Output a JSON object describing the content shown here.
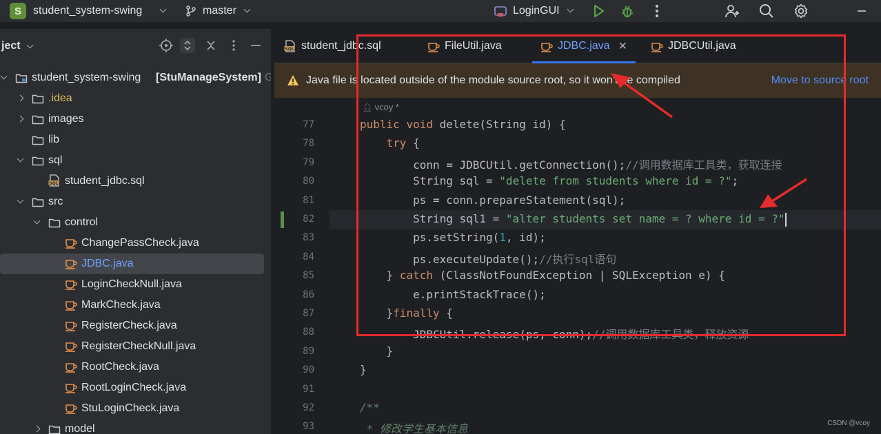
{
  "titlebar": {
    "project_badge": "S",
    "project_name": "student_system-swing",
    "branch": "master",
    "run_config": "LoginGUI",
    "icons": [
      "run-icon",
      "debug-icon",
      "more-vertical-icon",
      "add-user-icon",
      "search-icon",
      "settings-icon",
      "window-minimize-icon"
    ]
  },
  "sidebar": {
    "title": "ject",
    "tools": [
      "locate-icon",
      "expand-collapse-icon",
      "close-icon",
      "more-vertical-icon",
      "minimize-icon"
    ],
    "tree": [
      {
        "label": "student_system-swing",
        "suffix": "[StuManageSystem]",
        "extra": "G:",
        "kind": "module",
        "chev": "down"
      },
      {
        "label": ".idea",
        "kind": "folder",
        "chev": "right",
        "color": "#d6bf55"
      },
      {
        "label": "images",
        "kind": "folder",
        "chev": "right"
      },
      {
        "label": "lib",
        "kind": "folder",
        "chev": "none"
      },
      {
        "label": "sql",
        "kind": "folder",
        "chev": "down"
      },
      {
        "label": "student_jdbc.sql",
        "kind": "sql"
      },
      {
        "label": "src",
        "kind": "folder",
        "chev": "down"
      },
      {
        "label": "control",
        "kind": "folder",
        "chev": "down"
      },
      {
        "label": "ChangePassCheck.java",
        "kind": "java"
      },
      {
        "label": "JDBC.java",
        "kind": "java",
        "selected": true,
        "color": "#6ea2ff"
      },
      {
        "label": "LoginCheckNull.java",
        "kind": "java"
      },
      {
        "label": "MarkCheck.java",
        "kind": "java"
      },
      {
        "label": "RegisterCheck.java",
        "kind": "java"
      },
      {
        "label": "RegisterCheckNull.java",
        "kind": "java"
      },
      {
        "label": "RootCheck.java",
        "kind": "java"
      },
      {
        "label": "RootLoginCheck.java",
        "kind": "java"
      },
      {
        "label": "StuLoginCheck.java",
        "kind": "java"
      },
      {
        "label": "model",
        "kind": "folder",
        "chev": "right"
      }
    ]
  },
  "tabs": [
    {
      "label": "student_jdbc.sql",
      "kind": "sql"
    },
    {
      "label": "FileUtil.java",
      "kind": "java"
    },
    {
      "label": "JDBC.java",
      "kind": "java",
      "active": true
    },
    {
      "label": "JDBCUtil.java",
      "kind": "java"
    }
  ],
  "banner": {
    "text": "Java file is located outside of the module source root, so it won't be compiled",
    "link": "Move to source root"
  },
  "editor": {
    "author_hint": "vcoy *",
    "current_line": 82,
    "lines": [
      {
        "n": "77",
        "tokens": [
          [
            "kw",
            "public "
          ],
          [
            "kw",
            "void "
          ],
          [
            "",
            "delete(String id) {"
          ]
        ]
      },
      {
        "n": "78",
        "tokens": [
          [
            "",
            "    "
          ],
          [
            "kw",
            "try "
          ],
          [
            "",
            "{"
          ]
        ]
      },
      {
        "n": "79",
        "tokens": [
          [
            "",
            "        conn = JDBCUtil.getConnection();"
          ],
          [
            "cmt",
            "//调用数据库工具类，获取连接"
          ]
        ]
      },
      {
        "n": "80",
        "tokens": [
          [
            "",
            "        String sql = "
          ],
          [
            "str",
            "\"delete from students where id = ?\""
          ],
          [
            "",
            ";"
          ]
        ]
      },
      {
        "n": "81",
        "tokens": [
          [
            "",
            "        ps = conn.prepareStatement(sql);"
          ]
        ]
      },
      {
        "n": "82",
        "tokens": [
          [
            "",
            "        String sql1 = "
          ],
          [
            "str",
            "\"alter students set name = ? where id = ?\""
          ]
        ]
      },
      {
        "n": "83",
        "tokens": [
          [
            "",
            "        ps.setString("
          ],
          [
            "num",
            "1"
          ],
          [
            "",
            ", id);"
          ]
        ]
      },
      {
        "n": "84",
        "tokens": [
          [
            "",
            "        ps.executeUpdate();"
          ],
          [
            "cmt",
            "//执行sql语句"
          ]
        ]
      },
      {
        "n": "85",
        "tokens": [
          [
            "",
            "    } "
          ],
          [
            "kw",
            "catch "
          ],
          [
            "",
            "(ClassNotFoundException | SQLException e) {"
          ]
        ]
      },
      {
        "n": "86",
        "tokens": [
          [
            "",
            "        e.printStackTrace();"
          ]
        ]
      },
      {
        "n": "87",
        "tokens": [
          [
            "",
            "    }"
          ],
          [
            "kw",
            "finally "
          ],
          [
            "",
            "{"
          ]
        ]
      },
      {
        "n": "88",
        "tokens": [
          [
            "",
            "        JDBCUtil.release(ps, conn);"
          ],
          [
            "cmt",
            "//调用数据库工具类，释放资源"
          ]
        ]
      },
      {
        "n": "89",
        "tokens": [
          [
            "",
            "    }"
          ]
        ]
      },
      {
        "n": "90",
        "tokens": [
          [
            "",
            "}"
          ]
        ]
      },
      {
        "n": "91",
        "tokens": []
      },
      {
        "n": "92",
        "tokens": [
          [
            "doc",
            "/**"
          ]
        ]
      },
      {
        "n": "93",
        "tokens": [
          [
            "doc",
            " * 修改学生基本信息"
          ]
        ]
      }
    ]
  },
  "watermark": "CSDN @vcoy",
  "colors": {
    "annotation": "#e52b2b",
    "accent": "#3574f0",
    "banner_bg": "#3d3223"
  }
}
